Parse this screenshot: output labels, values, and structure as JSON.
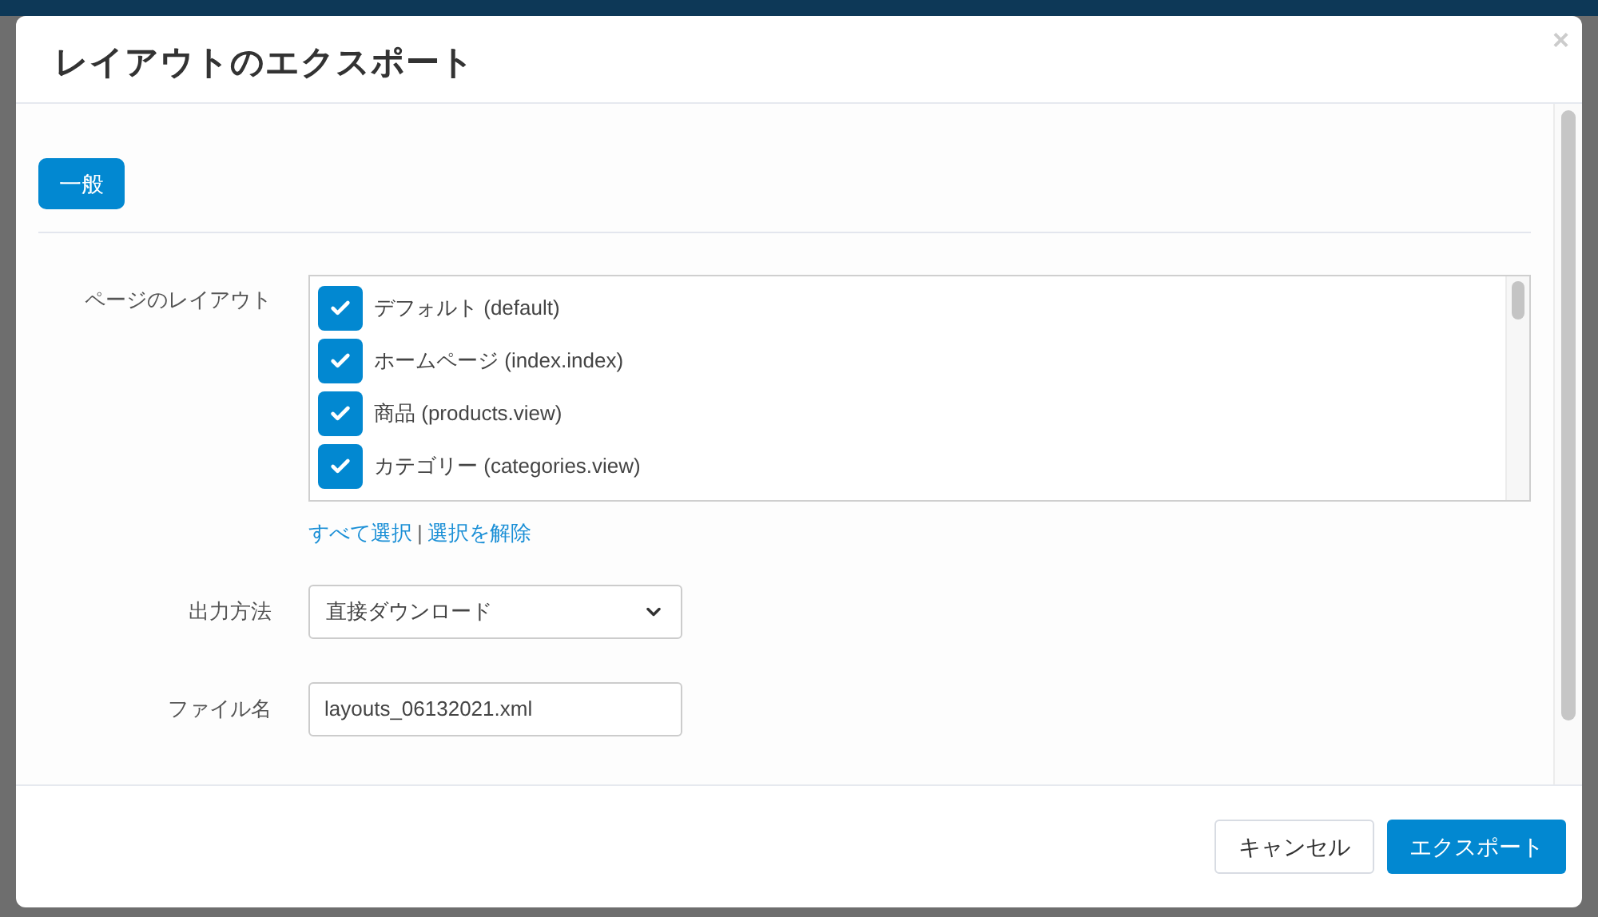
{
  "dialog": {
    "title": "レイアウトのエクスポート",
    "close": "×"
  },
  "tabs": [
    {
      "label": "一般",
      "selected": true
    }
  ],
  "form": {
    "layouts_label": "ページのレイアウト",
    "layouts": [
      {
        "label": "デフォルト (default)",
        "checked": true
      },
      {
        "label": "ホームページ (index.index)",
        "checked": true
      },
      {
        "label": "商品 (products.view)",
        "checked": true
      },
      {
        "label": "カテゴリー (categories.view)",
        "checked": true
      }
    ],
    "select_all": "すべて選択",
    "separator": "|",
    "deselect": "選択を解除",
    "output_label": "出力方法",
    "output_value": "直接ダウンロード",
    "filename_label": "ファイル名",
    "filename_value": "layouts_06132021.xml"
  },
  "buttons": [
    {
      "label": "キャンセル",
      "kind": "secondary"
    },
    {
      "label": "エクスポート",
      "kind": "primary"
    }
  ]
}
